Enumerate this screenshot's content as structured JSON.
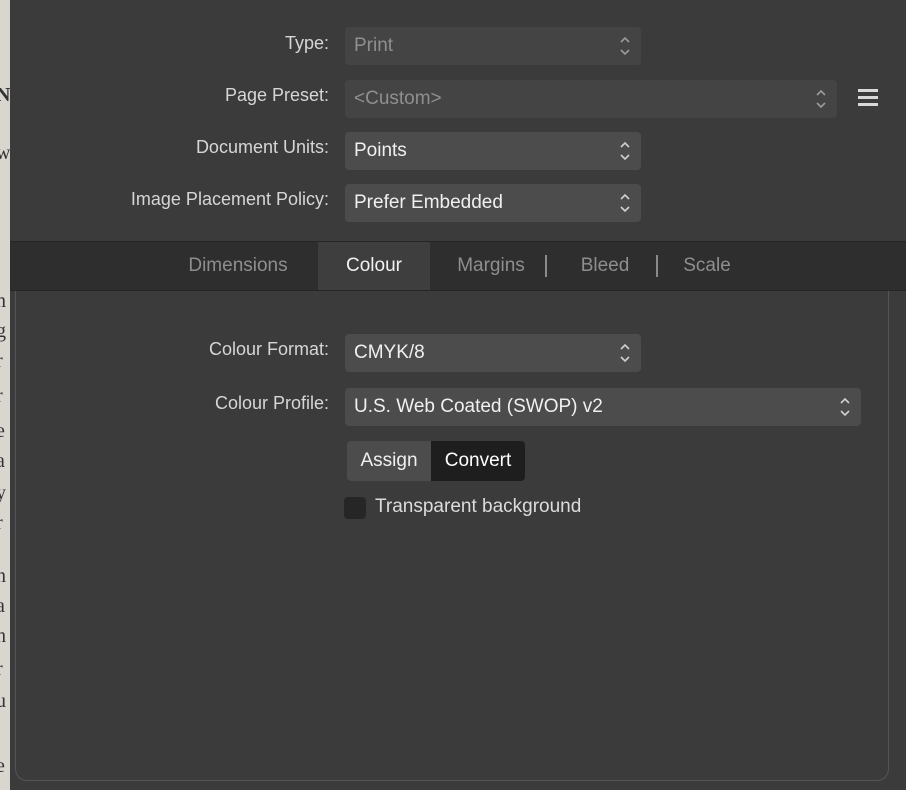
{
  "document": {
    "type": {
      "label": "Type:",
      "value": "Print"
    },
    "page_preset": {
      "label": "Page Preset:",
      "value": "<Custom>"
    },
    "document_units": {
      "label": "Document Units:",
      "value": "Points"
    },
    "image_placement_policy": {
      "label": "Image Placement Policy:",
      "value": "Prefer Embedded"
    }
  },
  "tabs": [
    {
      "label": "Dimensions",
      "active": false
    },
    {
      "label": "Colour",
      "active": true
    },
    {
      "label": "Margins",
      "active": false
    },
    {
      "label": "Bleed",
      "active": false
    },
    {
      "label": "Scale",
      "active": false
    }
  ],
  "colour": {
    "format": {
      "label": "Colour Format:",
      "value": "CMYK/8"
    },
    "profile": {
      "label": "Colour Profile:",
      "value": "U.S. Web Coated (SWOP) v2"
    },
    "assign_label": "Assign",
    "convert_label": "Convert",
    "selected_mode": "Convert",
    "transparent_background": {
      "label": "Transparent background",
      "checked": false
    }
  },
  "icons": {
    "preset_menu": "hamburger-menu-icon",
    "select_arrows": "chevron-up-down-icon"
  },
  "colors": {
    "background": "#3b3b3b",
    "control": "#4c4c4c",
    "tabbar": "#2e2e2e",
    "selected_segment": "#1e1e1e"
  }
}
